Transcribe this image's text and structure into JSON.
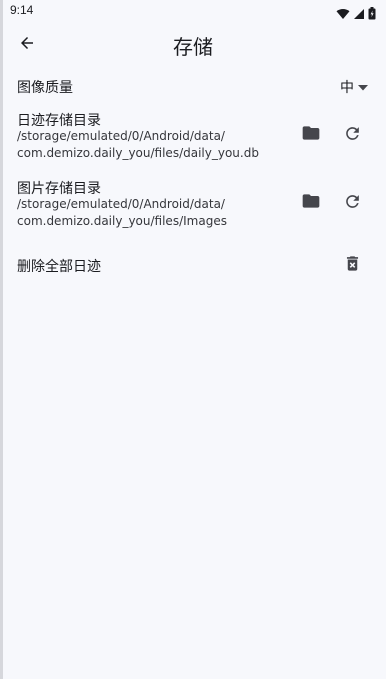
{
  "status_bar": {
    "time": "9:14",
    "icons": [
      "wifi-icon",
      "signal-icon",
      "battery-icon"
    ]
  },
  "app_bar": {
    "back_icon": "arrow-back-icon",
    "title": "存储"
  },
  "settings": {
    "image_quality": {
      "label": "图像质量",
      "value": "中",
      "dropdown_icon": "arrow-drop-down-icon"
    },
    "diary_storage": {
      "label": "日迹存储目录",
      "path": "/storage/emulated/0/Android/data/\ncom.demizo.daily_you/files/daily_you.db",
      "actions": [
        "folder-icon",
        "refresh-icon"
      ]
    },
    "image_storage": {
      "label": "图片存储目录",
      "path": "/storage/emulated/0/Android/data/\ncom.demizo.daily_you/files/Images",
      "actions": [
        "folder-icon",
        "refresh-icon"
      ]
    },
    "delete_all": {
      "label": "删除全部日迹",
      "icon": "delete-forever-icon"
    }
  },
  "colors": {
    "background": "#f7f8fc",
    "text": "#1b1c20",
    "icon": "#45464c"
  }
}
